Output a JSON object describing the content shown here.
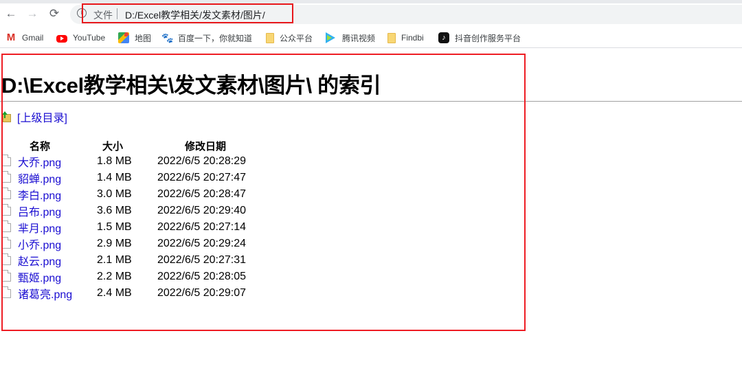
{
  "browser": {
    "nav": {
      "back": "←",
      "forward": "→",
      "reload": "⟳"
    },
    "omnibox": {
      "info_icon": "i",
      "scheme_label": "文件",
      "url": "D:/Excel教学相关/发文素材/图片/"
    },
    "bookmarks": [
      {
        "label": "Gmail",
        "icon": "gmail-icon",
        "glyph": "M"
      },
      {
        "label": "YouTube",
        "icon": "youtube-icon",
        "glyph": ""
      },
      {
        "label": "地图",
        "icon": "maps-icon",
        "glyph": ""
      },
      {
        "label": "百度一下，你就知道",
        "icon": "baidu-icon",
        "glyph": "🐾"
      },
      {
        "label": "公众平台",
        "icon": "folder-icon",
        "glyph": ""
      },
      {
        "label": "腾讯视频",
        "icon": "tencent-video-icon",
        "glyph": ""
      },
      {
        "label": "Findbi",
        "icon": "folder-icon",
        "glyph": ""
      },
      {
        "label": "抖音创作服务平台",
        "icon": "tiktok-icon",
        "glyph": "♪"
      }
    ]
  },
  "page": {
    "title": "D:\\Excel教学相关\\发文素材\\图片\\ 的索引",
    "parent_link": "[上级目录]",
    "columns": {
      "name": "名称",
      "size": "大小",
      "date": "修改日期"
    },
    "files": [
      {
        "name": "大乔.png",
        "size": "1.8 MB",
        "date": "2022/6/5 20:28:29"
      },
      {
        "name": "貂蝉.png",
        "size": "1.4 MB",
        "date": "2022/6/5 20:27:47"
      },
      {
        "name": "李白.png",
        "size": "3.0 MB",
        "date": "2022/6/5 20:28:47"
      },
      {
        "name": "吕布.png",
        "size": "3.6 MB",
        "date": "2022/6/5 20:29:40"
      },
      {
        "name": "芈月.png",
        "size": "1.5 MB",
        "date": "2022/6/5 20:27:14"
      },
      {
        "name": "小乔.png",
        "size": "2.9 MB",
        "date": "2022/6/5 20:29:24"
      },
      {
        "name": "赵云.png",
        "size": "2.1 MB",
        "date": "2022/6/5 20:27:31"
      },
      {
        "name": "甄姬.png",
        "size": "2.2 MB",
        "date": "2022/6/5 20:28:05"
      },
      {
        "name": "诸葛亮.png",
        "size": "2.4 MB",
        "date": "2022/6/5 20:29:07"
      }
    ]
  },
  "colors": {
    "link": "#1a0dd1",
    "annotation": "#ee1c23"
  }
}
